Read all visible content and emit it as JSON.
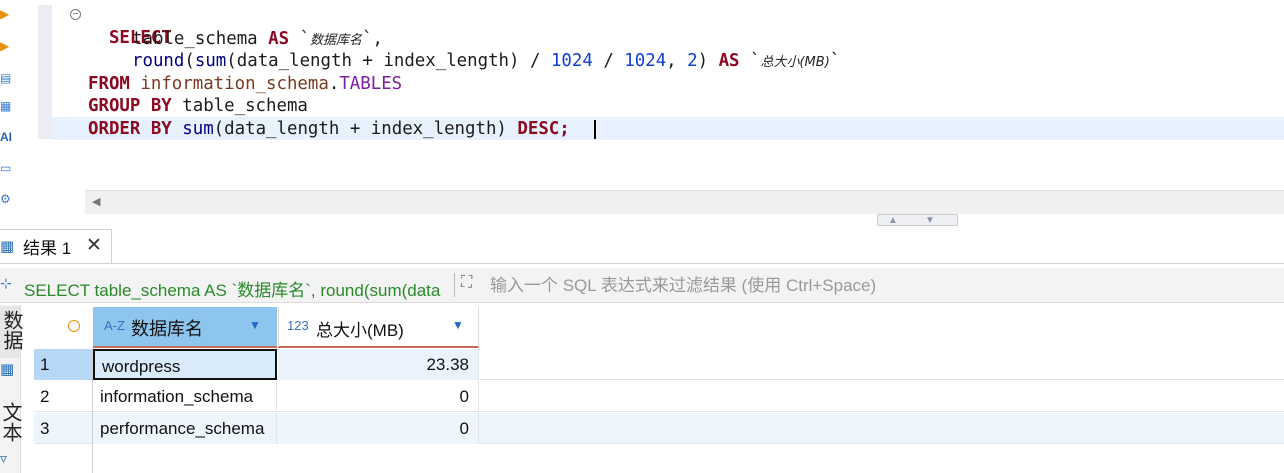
{
  "editor": {
    "lines": [
      {
        "kw": "SELECT"
      },
      {
        "col": "table_schema",
        "as": "AS",
        "alias": "数据库名",
        "comma": ","
      },
      {
        "fn_round": "round",
        "fn_sum": "sum",
        "arg1": "data_length",
        "plus": "+",
        "arg2": "index_length",
        "div1": "/",
        "n1": "1024",
        "div2": "/",
        "n2": "1024",
        "n3": "2",
        "as": "AS",
        "alias": "总大小(MB)"
      },
      {
        "kw": "FROM",
        "schema": "information_schema",
        "dot": ".",
        "table": "TABLES"
      },
      {
        "kw": "GROUP BY",
        "col": "table_schema"
      },
      {
        "kw": "ORDER BY",
        "fn_sum": "sum",
        "arg1": "data_length",
        "plus": "+",
        "arg2": "index_length",
        "desc": "DESC",
        "semi": ";"
      }
    ]
  },
  "results": {
    "tab_label": "结果 1",
    "filter_sql": "SELECT table_schema AS `数据库名`, round(sum(data",
    "filter_placeholder": "输入一个 SQL 表达式来过滤结果 (使用 Ctrl+Space)",
    "side_tabs": [
      "数据",
      "文本"
    ],
    "columns": [
      {
        "type_badge": "A-Z",
        "label": "数据库名"
      },
      {
        "type_badge": "123",
        "label": "总大小(MB)"
      }
    ],
    "rows": [
      {
        "num": "1",
        "name": "wordpress",
        "size": "23.38"
      },
      {
        "num": "2",
        "name": "information_schema",
        "size": "0"
      },
      {
        "num": "3",
        "name": "performance_schema",
        "size": "0"
      }
    ]
  },
  "colors": {
    "keyword": "#8b0a22",
    "number": "#1040d0",
    "selected_header": "#8ec5ee",
    "selected_row": "#b6d7f5"
  },
  "icons": [
    "run-icon",
    "run-script-icon",
    "explain-icon",
    "history-icon",
    "ai-icon",
    "folder-icon",
    "settings-icon",
    "grid-icon",
    "close-icon",
    "expand-icon",
    "dropdown-arrow-icon",
    "scroll-left-icon",
    "sash-up-icon",
    "sash-down-icon",
    "fold-icon"
  ]
}
